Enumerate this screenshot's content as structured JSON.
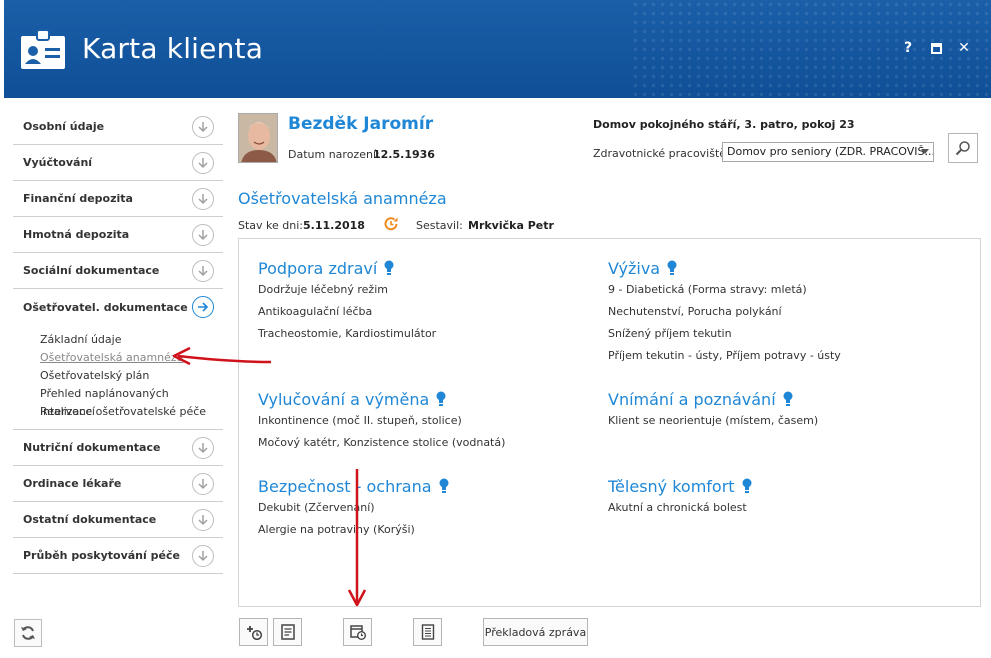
{
  "window": {
    "title": "Karta klienta",
    "help_label": "?",
    "maximize_label": "■",
    "close_label": "✕"
  },
  "sidebar": {
    "items_top": [
      {
        "label": "Osobní údaje"
      },
      {
        "label": "Vyúčtování"
      },
      {
        "label": "Finanční depozita"
      },
      {
        "label": "Hmotná depozita"
      },
      {
        "label": "Sociální dokumentace"
      }
    ],
    "active_item": {
      "label": "Ošetřovatel. dokumentace"
    },
    "sub_items": [
      {
        "label": "Základní údaje"
      },
      {
        "label": "Ošetřovatelská anamnéza"
      },
      {
        "label": "Ošetřovatelský plán"
      },
      {
        "label": "Přehled naplánovaných intervencí"
      },
      {
        "label": "Realizace ošetřovatelské péče"
      }
    ],
    "items_bottom": [
      {
        "label": "Nutriční dokumentace"
      },
      {
        "label": "Ordinace lékaře"
      },
      {
        "label": "Ostatní dokumentace"
      },
      {
        "label": "Průběh poskytování péče"
      }
    ]
  },
  "client": {
    "name": "Bezděk Jaromír",
    "dob_label": "Datum narození:",
    "dob": "12.5.1936",
    "facility": "Domov pokojného stáří, 3. patro, pokoj 23",
    "workplace_label": "Zdravotnické pracoviště:",
    "workplace_value": "Domov pro seniory (ZDR. PRACOVIŠ..."
  },
  "section": {
    "title": "Ošetřovatelská anamnéza",
    "state_label": "Stav ke dni:",
    "state_date": "5.11.2018",
    "author_label": "Sestavil:",
    "author": "Mrkvička Petr"
  },
  "cards": {
    "podpora": {
      "title": "Podpora zdraví",
      "lines": [
        "Dodržuje léčebný režim",
        "Antikoagulační léčba",
        "Tracheostomie, Kardiostimulátor"
      ]
    },
    "vyziva": {
      "title": "Výživa",
      "lines": [
        "9 - Diabetická (Forma stravy: mletá)",
        "Nechutenství, Porucha polykání",
        "Snížený příjem tekutin",
        "Příjem tekutin - ústy, Příjem potravy - ústy"
      ]
    },
    "vylucovani": {
      "title": "Vylučování a výměna",
      "lines": [
        "Inkontinence (moč II. stupeň, stolice)",
        "Močový katétr, Konzistence stolice (vodnatá)"
      ]
    },
    "vnimani": {
      "title": "Vnímání a poznávání",
      "lines": [
        "Klient se neorientuje (místem, časem)"
      ]
    },
    "bezpecnost": {
      "title": "Bezpečnost - ochrana",
      "lines": [
        "Dekubit (Zčervenání)",
        "Alergie na potraviny (Korýši)"
      ]
    },
    "komfort": {
      "title": "Tělesný komfort",
      "lines": [
        "Akutní a chronická bolest"
      ]
    }
  },
  "toolbar": {
    "report_label": "Překladová zpráva"
  },
  "colors": {
    "titlebar": "#1a5fa8",
    "accent": "#1f87d6",
    "annotation_arrow": "#d0121b",
    "clock": "#f08a1c"
  },
  "icons": [
    "id-card-icon",
    "help-icon",
    "maximize-icon",
    "close-icon",
    "chevron-down-circle-icon",
    "arrow-right-circle-icon",
    "refresh-icon",
    "search-icon",
    "clock-icon",
    "lightbulb-icon",
    "add-schedule-icon",
    "notes-icon",
    "calendar-clock-icon",
    "document-icon"
  ]
}
